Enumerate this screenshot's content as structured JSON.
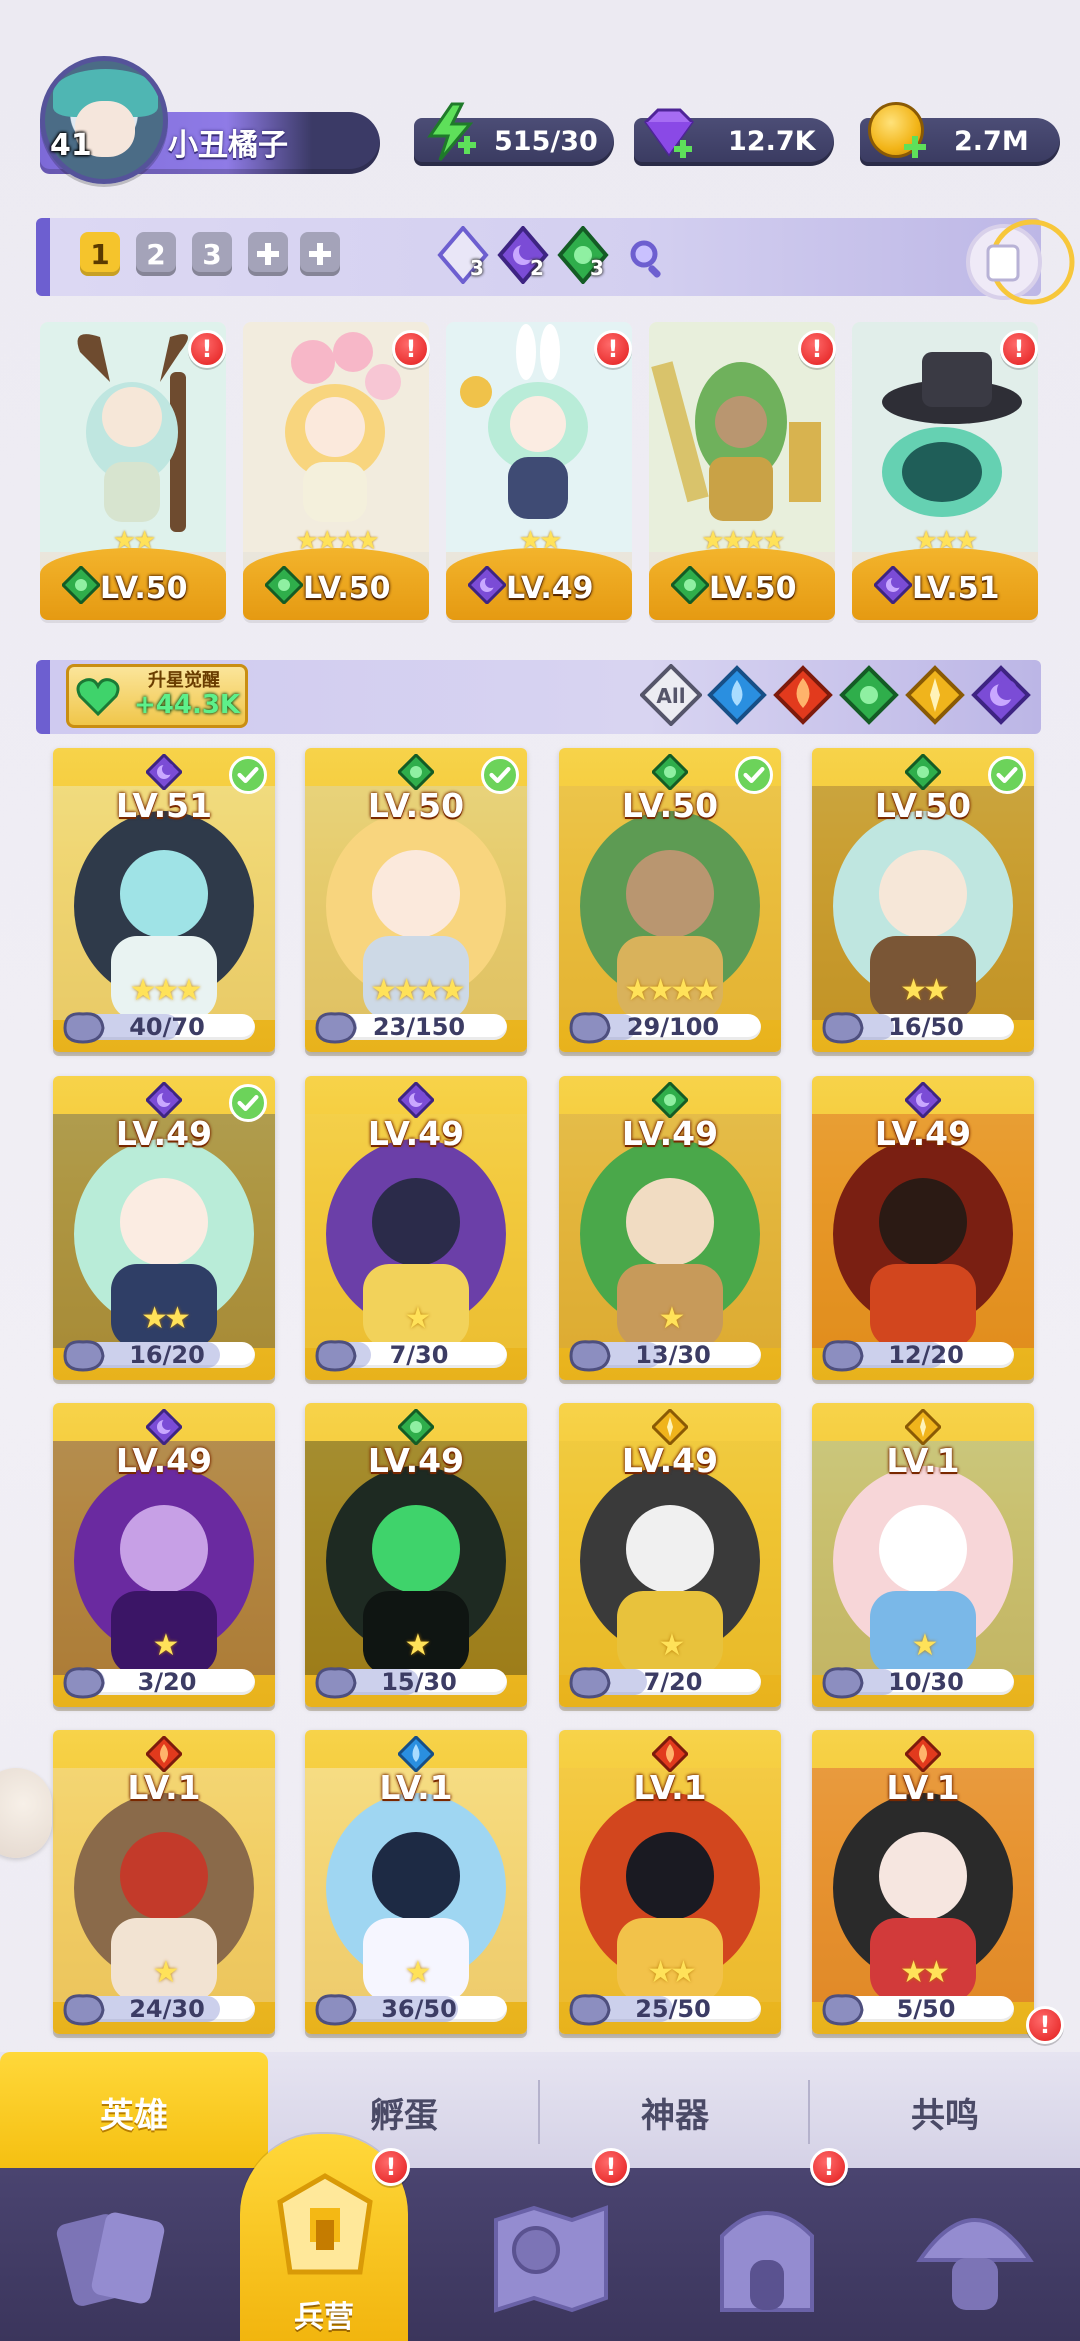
{
  "player": {
    "level": "41",
    "name": "小丑橘子"
  },
  "resources": {
    "energy": "515/30",
    "gems": "12.7K",
    "gold": "2.7M"
  },
  "team_tabs": [
    "1",
    "2",
    "3"
  ],
  "element_counts": {
    "light": "3",
    "dark": "2",
    "nature": "3"
  },
  "team": [
    {
      "level": "LV.50",
      "element": "nature",
      "stars": "★★"
    },
    {
      "level": "LV.50",
      "element": "nature",
      "stars": "★★★★"
    },
    {
      "level": "LV.49",
      "element": "dark",
      "stars": "★★"
    },
    {
      "level": "LV.50",
      "element": "nature",
      "stars": "★★★★"
    },
    {
      "level": "LV.51",
      "element": "dark",
      "stars": "★★★"
    }
  ],
  "awaken": {
    "title": "升星觉醒",
    "value": "+44.3K"
  },
  "filters": [
    "All",
    "water",
    "fire",
    "nature",
    "light",
    "dark"
  ],
  "heroes": [
    {
      "level": "LV.51",
      "element": "dark",
      "progress": "40/70",
      "ratio": 0.571,
      "checked": true,
      "stars": "★★★"
    },
    {
      "level": "LV.50",
      "element": "nature",
      "progress": "23/150",
      "ratio": 0.153,
      "checked": true,
      "stars": "★★★★"
    },
    {
      "level": "LV.50",
      "element": "nature",
      "progress": "29/100",
      "ratio": 0.29,
      "checked": true,
      "stars": "★★★★"
    },
    {
      "level": "LV.50",
      "element": "nature",
      "progress": "16/50",
      "ratio": 0.32,
      "checked": true,
      "stars": "★★"
    },
    {
      "level": "LV.49",
      "element": "dark",
      "progress": "16/20",
      "ratio": 0.8,
      "checked": true,
      "stars": "★★"
    },
    {
      "level": "LV.49",
      "element": "dark",
      "progress": "7/30",
      "ratio": 0.233,
      "checked": false,
      "stars": "★"
    },
    {
      "level": "LV.49",
      "element": "nature",
      "progress": "13/30",
      "ratio": 0.433,
      "checked": false,
      "stars": "★"
    },
    {
      "level": "LV.49",
      "element": "dark",
      "progress": "12/20",
      "ratio": 0.6,
      "checked": false,
      "stars": ""
    },
    {
      "level": "LV.49",
      "element": "dark",
      "progress": "3/20",
      "ratio": 0.15,
      "checked": false,
      "stars": "★"
    },
    {
      "level": "LV.49",
      "element": "nature",
      "progress": "15/30",
      "ratio": 0.5,
      "checked": false,
      "stars": "★"
    },
    {
      "level": "LV.49",
      "element": "light",
      "progress": "7/20",
      "ratio": 0.35,
      "checked": false,
      "stars": "★"
    },
    {
      "level": "LV.1",
      "element": "light",
      "progress": "10/30",
      "ratio": 0.333,
      "checked": false,
      "stars": "★"
    },
    {
      "level": "LV.1",
      "element": "fire",
      "progress": "24/30",
      "ratio": 0.8,
      "checked": false,
      "stars": "★"
    },
    {
      "level": "LV.1",
      "element": "water",
      "progress": "36/50",
      "ratio": 0.72,
      "checked": false,
      "stars": "★"
    },
    {
      "level": "LV.1",
      "element": "fire",
      "progress": "25/50",
      "ratio": 0.5,
      "checked": false,
      "stars": "★★"
    },
    {
      "level": "LV.1",
      "element": "fire",
      "progress": "5/50",
      "ratio": 0.1,
      "checked": false,
      "stars": "★★"
    }
  ],
  "sub_tabs": [
    "英雄",
    "孵蛋",
    "神器",
    "共鸣"
  ],
  "nav": {
    "active_label": "兵营",
    "items": [
      "cards-icon",
      "barracks-icon",
      "map-icon",
      "castle-icon",
      "mushroom-icon"
    ]
  },
  "alert_mark": "!",
  "colors": {
    "accent_yellow": "#f5c42c",
    "nature": "#2fae4b",
    "dark": "#7b4cd6",
    "fire": "#e23a1d",
    "water": "#2a8fe0",
    "light": "#f0b41c",
    "alert": "#e21c1c"
  }
}
